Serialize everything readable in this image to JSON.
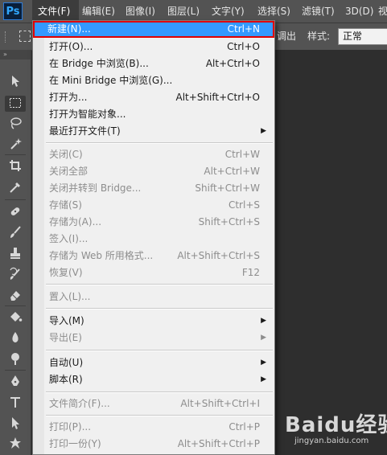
{
  "app": {
    "logo": "Ps"
  },
  "menubar": {
    "items": [
      "文件(F)",
      "编辑(E)",
      "图像(I)",
      "图层(L)",
      "文字(Y)",
      "选择(S)",
      "滤镜(T)",
      "3D(D)",
      "视"
    ]
  },
  "options_bar": {
    "partial_text": "调出",
    "style_label": "样式:",
    "style_value": "正常"
  },
  "toolbar": {
    "collapse": "»",
    "tools": [
      "move-tool",
      "marquee-tool",
      "lasso-tool",
      "magic-wand-tool",
      "crop-tool",
      "eyedropper-tool",
      "healing-brush-tool",
      "brush-tool",
      "clone-stamp-tool",
      "history-brush-tool",
      "eraser-tool",
      "paint-bucket-tool",
      "blur-tool",
      "dodge-tool",
      "pen-tool",
      "type-tool",
      "path-selection-tool",
      "shape-tool"
    ]
  },
  "file_menu": {
    "items": [
      {
        "label": "新建(N)...",
        "shortcut": "Ctrl+N"
      },
      {
        "label": "打开(O)...",
        "shortcut": "Ctrl+O"
      },
      {
        "label": "在 Bridge 中浏览(B)...",
        "shortcut": "Alt+Ctrl+O"
      },
      {
        "label": "在 Mini Bridge 中浏览(G)...",
        "shortcut": ""
      },
      {
        "label": "打开为...",
        "shortcut": "Alt+Shift+Ctrl+O"
      },
      {
        "label": "打开为智能对象...",
        "shortcut": ""
      },
      {
        "label": "最近打开文件(T)",
        "shortcut": ""
      },
      {
        "label": "关闭(C)",
        "shortcut": "Ctrl+W"
      },
      {
        "label": "关闭全部",
        "shortcut": "Alt+Ctrl+W"
      },
      {
        "label": "关闭并转到 Bridge...",
        "shortcut": "Shift+Ctrl+W"
      },
      {
        "label": "存储(S)",
        "shortcut": "Ctrl+S"
      },
      {
        "label": "存储为(A)...",
        "shortcut": "Shift+Ctrl+S"
      },
      {
        "label": "签入(I)...",
        "shortcut": ""
      },
      {
        "label": "存储为 Web 所用格式...",
        "shortcut": "Alt+Shift+Ctrl+S"
      },
      {
        "label": "恢复(V)",
        "shortcut": "F12"
      },
      {
        "label": "置入(L)...",
        "shortcut": ""
      },
      {
        "label": "导入(M)",
        "shortcut": ""
      },
      {
        "label": "导出(E)",
        "shortcut": ""
      },
      {
        "label": "自动(U)",
        "shortcut": ""
      },
      {
        "label": "脚本(R)",
        "shortcut": ""
      },
      {
        "label": "文件简介(F)...",
        "shortcut": "Alt+Shift+Ctrl+I"
      },
      {
        "label": "打印(P)...",
        "shortcut": "Ctrl+P"
      },
      {
        "label": "打印一份(Y)",
        "shortcut": "Alt+Shift+Ctrl+P"
      }
    ]
  },
  "watermark": {
    "brand": "Baidu经验",
    "url": "jingyan.baidu.com"
  }
}
